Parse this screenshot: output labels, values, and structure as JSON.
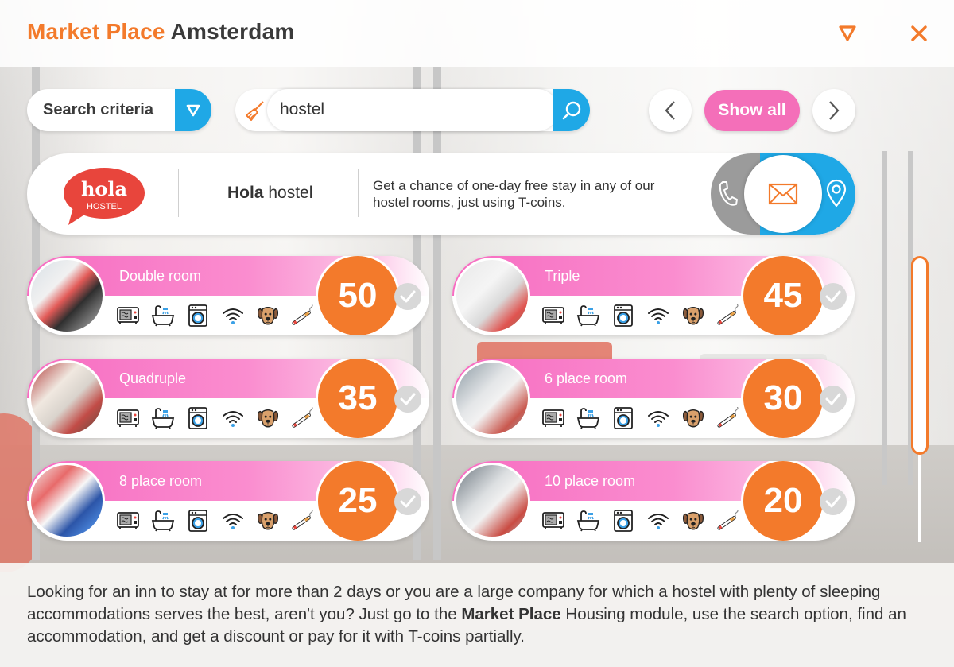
{
  "header": {
    "title_accent": "Market Place",
    "title_city": "Amsterdam",
    "menu_icon": "triangle-down-icon",
    "close_icon": "close-icon"
  },
  "search": {
    "criteria_label": "Search criteria",
    "query": "hostel",
    "show_all_label": "Show all"
  },
  "vendor": {
    "logo_text": "hola",
    "logo_subtext": "HOSTEL",
    "name_bold": "Hola",
    "name_rest": "hostel",
    "description": "Get a chance of one-day free stay in any of our hostel rooms, just using T-coins.",
    "contacts": [
      "phone-icon",
      "mail-icon",
      "location-pin-icon"
    ]
  },
  "rooms": [
    {
      "name": "Double room",
      "price": "50"
    },
    {
      "name": "Triple",
      "price": "45"
    },
    {
      "name": "Quadruple",
      "price": "35"
    },
    {
      "name": "6 place room",
      "price": "30"
    },
    {
      "name": "8 place room",
      "price": "25"
    },
    {
      "name": "10 place room",
      "price": "20"
    }
  ],
  "amenities": [
    "microwave-icon",
    "bathtub-icon",
    "washing-machine-icon",
    "wifi-icon",
    "dog-icon",
    "cigarette-icon"
  ],
  "footer": {
    "text_before": "Looking for an inn to stay at for more than 2 days or you are a large company for which a hostel with plenty of sleeping accommodations serves the best, aren't you? Just go to the ",
    "text_bold": "Market Place",
    "text_after": " Housing module, use the search option, find an accommodation, and get a discount or pay for it with T-coins partially."
  },
  "colors": {
    "accent_orange": "#f37a2b",
    "accent_pink": "#f46fb9",
    "accent_blue": "#1fa8e6"
  }
}
